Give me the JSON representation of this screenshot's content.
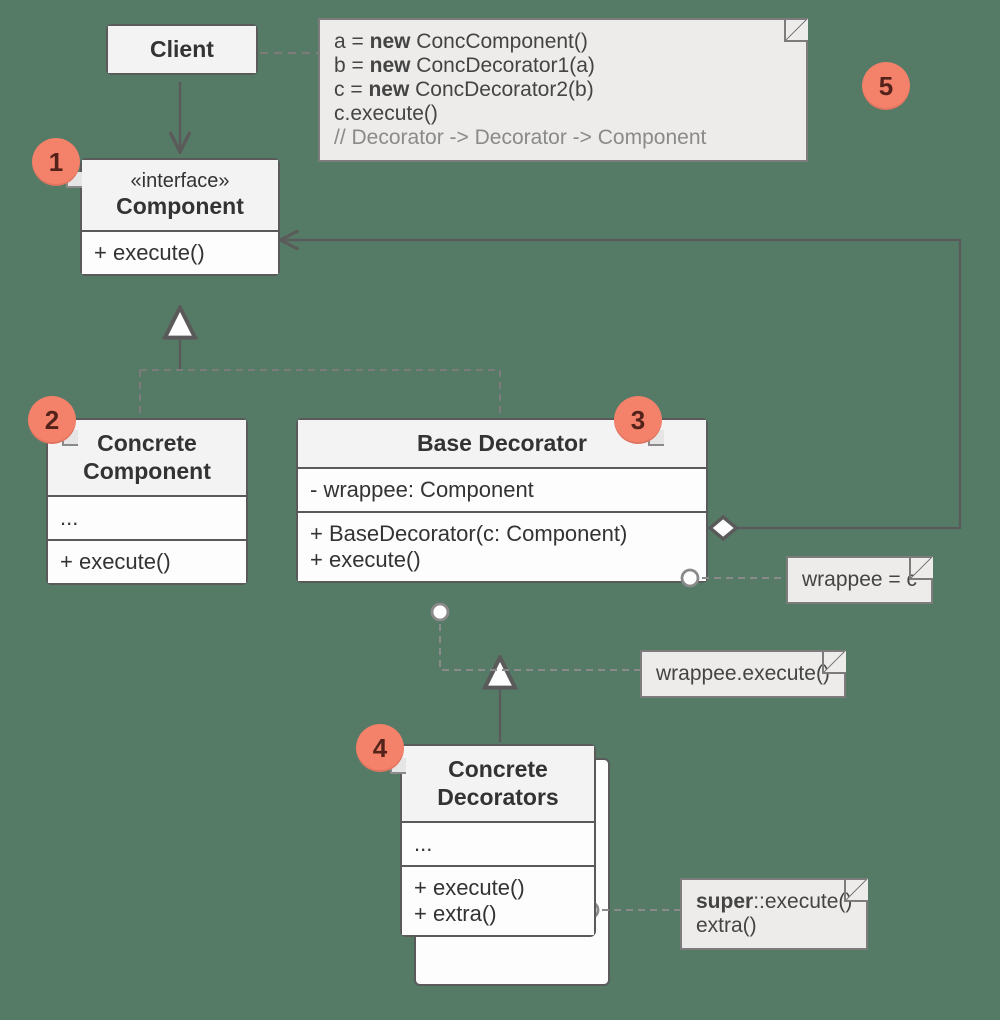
{
  "badges": {
    "b1": "1",
    "b2": "2",
    "b3": "3",
    "b4": "4",
    "b5": "5"
  },
  "client": {
    "title": "Client"
  },
  "component": {
    "stereotype": "«interface»",
    "name": "Component",
    "m1": "+ execute()"
  },
  "concreteComponent": {
    "name": "Concrete Component",
    "s1": "...",
    "m1": "+ execute()"
  },
  "baseDecorator": {
    "name": "Base Decorator",
    "f1": "- wrappee: Component",
    "m1": "+ BaseDecorator(c: Component)",
    "m2": "+ execute()"
  },
  "concreteDecorators": {
    "name": "Concrete Decorators",
    "s1": "...",
    "m1": "+ execute()",
    "m2": "+ extra()"
  },
  "noteCode": {
    "l1a": "a = ",
    "l1b": "new",
    "l1c": " ConcComponent()",
    "l2a": "b = ",
    "l2b": "new",
    "l2c": " ConcDecorator1(a)",
    "l3a": "c = ",
    "l3b": "new",
    "l3c": " ConcDecorator2(b)",
    "l4": "c.execute()",
    "l5": "// Decorator -> Decorator -> Component"
  },
  "noteWrappeeC": "wrappee = c",
  "noteWrappeeExec": "wrappee.execute()",
  "noteSuper": {
    "a": "super",
    "b": "::execute()",
    "c": "extra()"
  }
}
